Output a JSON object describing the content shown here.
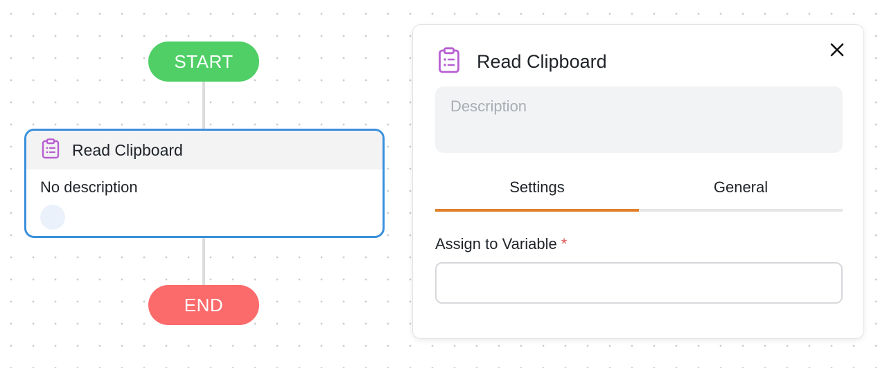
{
  "colors": {
    "start_green": "#4fcf66",
    "end_red": "#fb6b6b",
    "node_border_blue": "#3a8fdb",
    "clipboard_icon_purple": "#b75fd1",
    "active_tab_orange": "#e0812a",
    "required_red": "#d9534f"
  },
  "flow": {
    "start_label": "START",
    "end_label": "END",
    "node": {
      "icon": "clipboard-icon",
      "title": "Read Clipboard",
      "description": "No description"
    }
  },
  "panel": {
    "icon": "clipboard-icon",
    "title": "Read Clipboard",
    "close_icon": "close-icon",
    "description": {
      "placeholder": "Description",
      "value": ""
    },
    "tabs": [
      {
        "label": "Settings",
        "active": true
      },
      {
        "label": "General",
        "active": false
      }
    ],
    "assign_variable": {
      "label": "Assign to Variable",
      "required_mark": "*",
      "value": ""
    }
  }
}
